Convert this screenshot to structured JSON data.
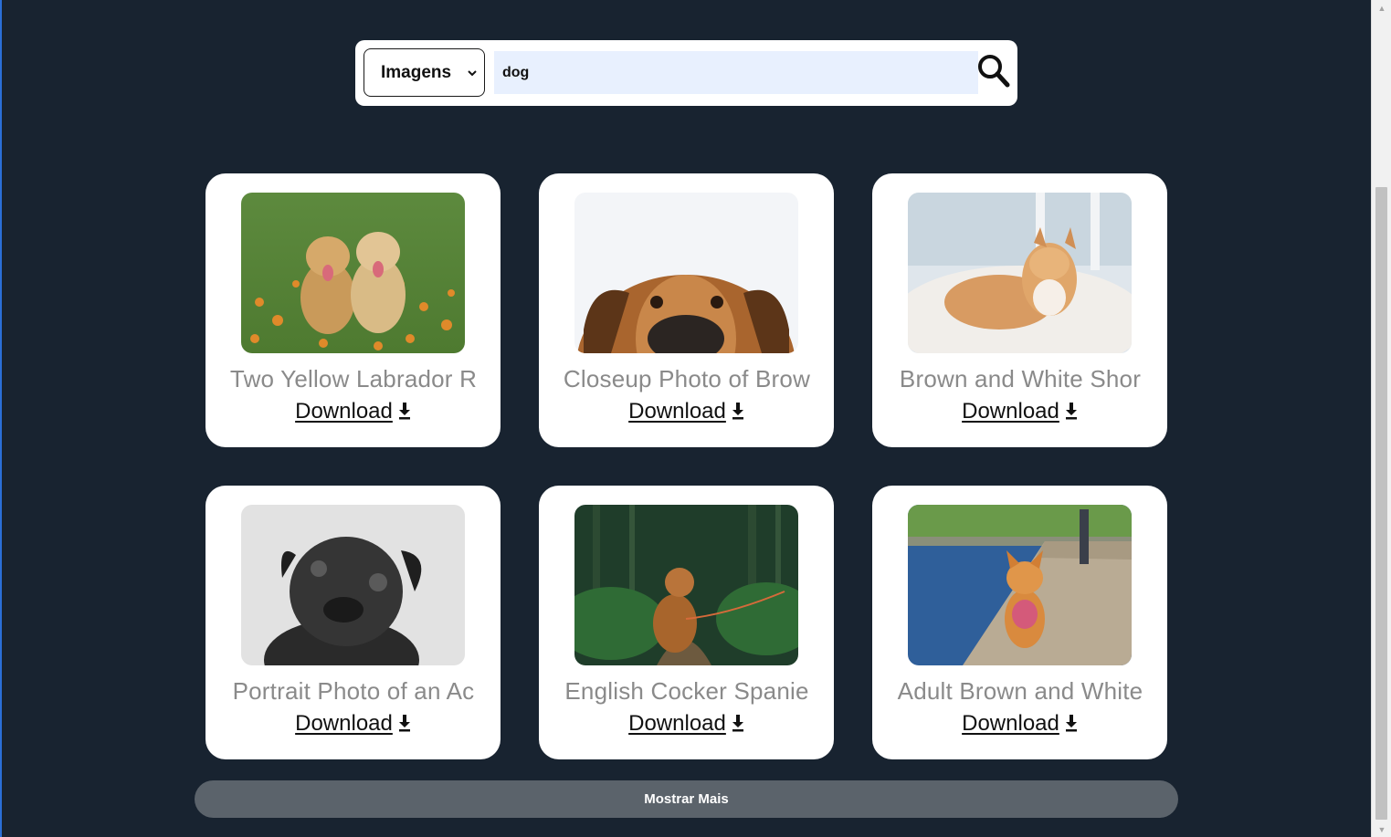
{
  "search": {
    "type_selected": "Imagens",
    "query": "dog"
  },
  "results": [
    {
      "title": "Two Yellow Labrador R",
      "download_label": "Download"
    },
    {
      "title": "Closeup Photo of Brow",
      "download_label": "Download"
    },
    {
      "title": "Brown and White Shor",
      "download_label": "Download"
    },
    {
      "title": "Portrait Photo of an Ac",
      "download_label": "Download"
    },
    {
      "title": "English Cocker Spanie",
      "download_label": "Download"
    },
    {
      "title": "Adult Brown and White",
      "download_label": "Download"
    }
  ],
  "icons": {
    "search": "magnifier-icon",
    "download": "download-arrow-icon",
    "select_caret": "chevron-down-icon"
  },
  "more_button_label": "Mostrar Mais",
  "colors": {
    "background": "#182330",
    "card": "#ffffff",
    "title_text": "#8a8a8a",
    "search_input_bg": "#e8f0fe",
    "more_button": "#5b636b"
  }
}
